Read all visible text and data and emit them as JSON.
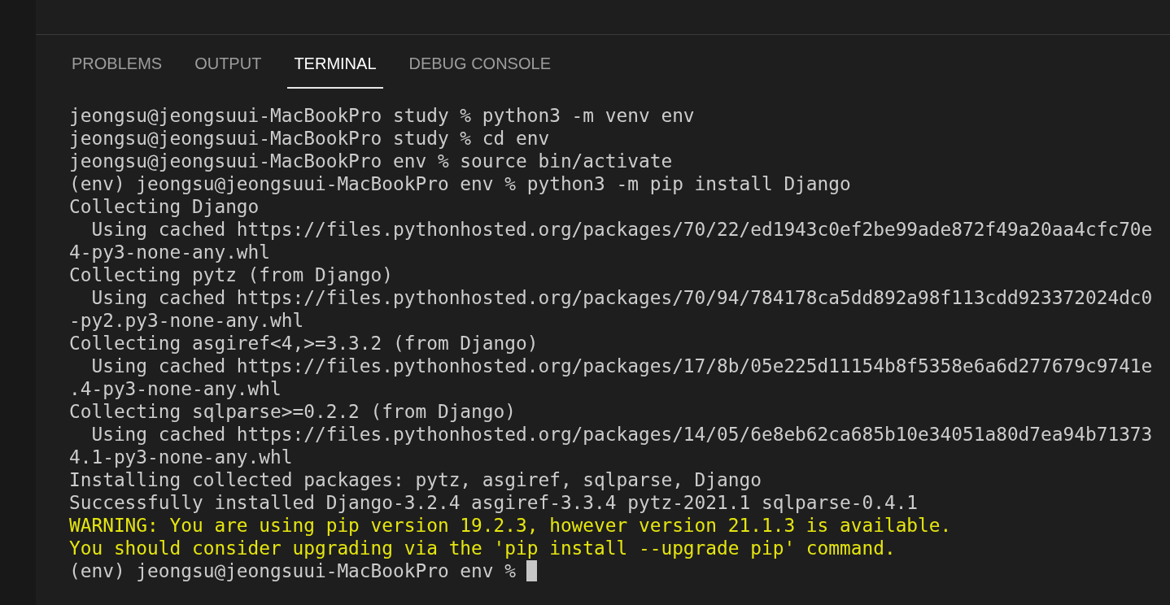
{
  "panel": {
    "tabs": [
      {
        "label": "PROBLEMS",
        "selected": false
      },
      {
        "label": "OUTPUT",
        "selected": false
      },
      {
        "label": "TERMINAL",
        "selected": true
      },
      {
        "label": "DEBUG CONSOLE",
        "selected": false
      }
    ]
  },
  "terminal": {
    "lines": [
      {
        "kind": "output",
        "text": "jeongsu@jeongsuui-MacBookPro study % python3 -m venv env"
      },
      {
        "kind": "output",
        "text": "jeongsu@jeongsuui-MacBookPro study % cd env"
      },
      {
        "kind": "output",
        "text": "jeongsu@jeongsuui-MacBookPro env % source bin/activate"
      },
      {
        "kind": "output",
        "text": "(env) jeongsu@jeongsuui-MacBookPro env % python3 -m pip install Django"
      },
      {
        "kind": "output",
        "text": "Collecting Django"
      },
      {
        "kind": "output",
        "text": "  Using cached https://files.pythonhosted.org/packages/70/22/ed1943c0ef2be99ade872f49a20aa4cfc70e"
      },
      {
        "kind": "output",
        "text": "4-py3-none-any.whl"
      },
      {
        "kind": "output",
        "text": "Collecting pytz (from Django)"
      },
      {
        "kind": "output",
        "text": "  Using cached https://files.pythonhosted.org/packages/70/94/784178ca5dd892a98f113cdd923372024dc0"
      },
      {
        "kind": "output",
        "text": "-py2.py3-none-any.whl"
      },
      {
        "kind": "output",
        "text": "Collecting asgiref<4,>=3.3.2 (from Django)"
      },
      {
        "kind": "output",
        "text": "  Using cached https://files.pythonhosted.org/packages/17/8b/05e225d11154b8f5358e6a6d277679c9741e"
      },
      {
        "kind": "output",
        "text": ".4-py3-none-any.whl"
      },
      {
        "kind": "output",
        "text": "Collecting sqlparse>=0.2.2 (from Django)"
      },
      {
        "kind": "output",
        "text": "  Using cached https://files.pythonhosted.org/packages/14/05/6e8eb62ca685b10e34051a80d7ea94b71373"
      },
      {
        "kind": "output",
        "text": "4.1-py3-none-any.whl"
      },
      {
        "kind": "output",
        "text": "Installing collected packages: pytz, asgiref, sqlparse, Django"
      },
      {
        "kind": "output",
        "text": "Successfully installed Django-3.2.4 asgiref-3.3.4 pytz-2021.1 sqlparse-0.4.1"
      },
      {
        "kind": "warning",
        "text": "WARNING: You are using pip version 19.2.3, however version 21.1.3 is available."
      },
      {
        "kind": "warning",
        "text": "You should consider upgrading via the 'pip install --upgrade pip' command."
      }
    ],
    "prompt": {
      "text": "(env) jeongsu@jeongsuui-MacBookPro env %",
      "cursor": true
    }
  }
}
